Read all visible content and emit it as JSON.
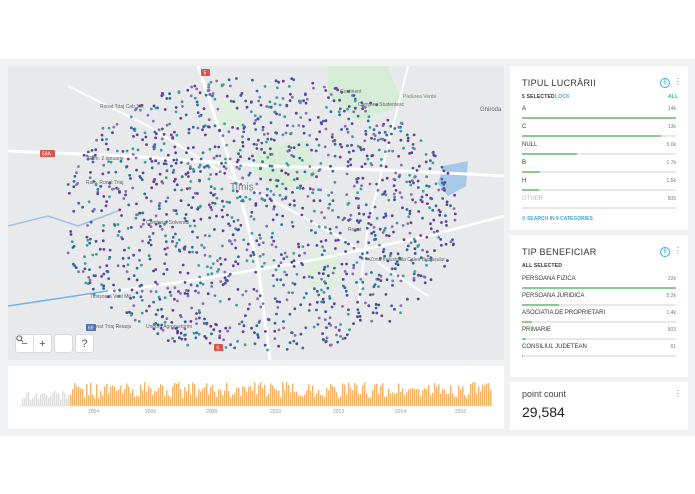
{
  "map": {
    "labels": [
      "Ronat Triaj Cab 1 R",
      "Ram. Ronat Triaj",
      "Ram. 2 Ianuarie",
      "Combinat Solventul",
      "Timișoara Vest Mil.",
      "Ronat Triaj Reiaqu",
      "Timiș",
      "Complex Studentesc",
      "Padurea Verde",
      "Ghiroda",
      "Zona Industriala Calea Buziașului",
      "Unirom Agropurtorim",
      "Continent",
      "Ronat"
    ],
    "road_badges": [
      "5",
      "59A",
      "69",
      "6"
    ],
    "zoom": {
      "minus": "−",
      "plus": "+",
      "search_icon": "search-icon",
      "help": "?"
    }
  },
  "timeline": {
    "years": [
      "2004",
      "2006",
      "2008",
      "2010",
      "2012",
      "2014",
      "2016"
    ],
    "bar_color": "#f5b461"
  },
  "panels": {
    "tipul": {
      "title": "TIPUL LUCRĂRII",
      "selected": "5 SELECTED",
      "lock": "LOCK",
      "all": "ALL",
      "items": [
        {
          "label": "A",
          "value": "14k",
          "pct": 1.0
        },
        {
          "label": "C",
          "value": "13k",
          "pct": 0.9
        },
        {
          "label": "NULL",
          "value": "5.0k",
          "pct": 0.36
        },
        {
          "label": "B",
          "value": "1.7k",
          "pct": 0.12
        },
        {
          "label": "H",
          "value": "1.5k",
          "pct": 0.11
        },
        {
          "label": "OTHER",
          "value": "505",
          "pct": 0.04
        }
      ],
      "search": "SEARCH IN 9 CATEGORIES"
    },
    "beneficiar": {
      "title": "TIP BENEFICIAR",
      "selected": "ALL SELECTED",
      "items": [
        {
          "label": "PERSOANA FIZICA",
          "value": "22k",
          "pct": 1.0
        },
        {
          "label": "PERSOANA JURIDICA",
          "value": "5.2k",
          "pct": 0.24
        },
        {
          "label": "ASOCIATIA DE PROPRIETARI",
          "value": "1.4k",
          "pct": 0.065
        },
        {
          "label": "PRIMARIE",
          "value": "503",
          "pct": 0.023
        },
        {
          "label": "CONSILIUL JUDETEAN",
          "value": "61",
          "pct": 0.003
        }
      ]
    },
    "count": {
      "title": "point count",
      "value": "29,584"
    }
  },
  "colors": {
    "accent": "#3aa6dd",
    "bar_green": "#8bcb8f",
    "dot_purple": "#6a3d9a",
    "dot_blue": "#2f6f9f",
    "dot_teal": "#3a9fa0"
  }
}
